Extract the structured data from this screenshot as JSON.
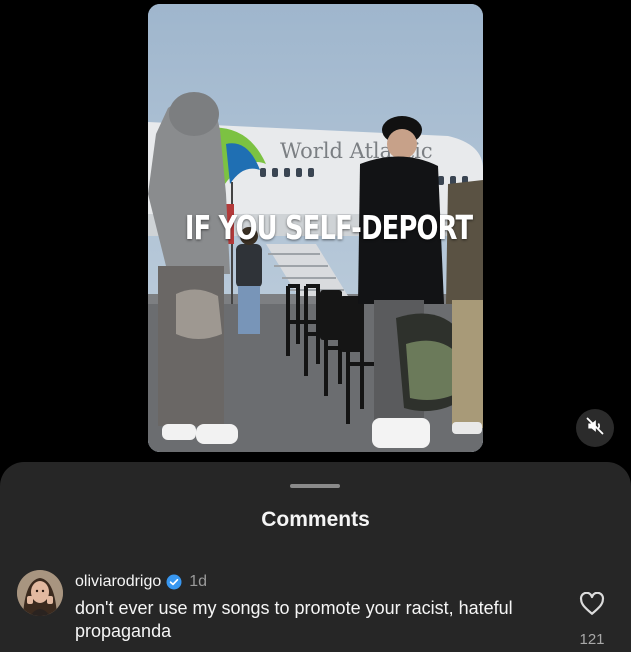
{
  "video": {
    "overlay_caption": "IF YOU SELF-DEPORT",
    "airplane_text": "World Atlantic",
    "mute_icon": "speaker-muted-icon"
  },
  "comments_sheet": {
    "title": "Comments",
    "comments": [
      {
        "username": "oliviarodrigo",
        "verified": true,
        "time": "1d",
        "text": "don't ever use my songs to promote your racist, hateful propaganda",
        "like_count": "121",
        "like_icon": "heart-icon"
      }
    ]
  },
  "colors": {
    "background": "#000000",
    "sheet": "#262626",
    "text_primary": "#f5f5f5",
    "text_secondary": "#9a9a9a",
    "verified_blue": "#3897f0"
  }
}
